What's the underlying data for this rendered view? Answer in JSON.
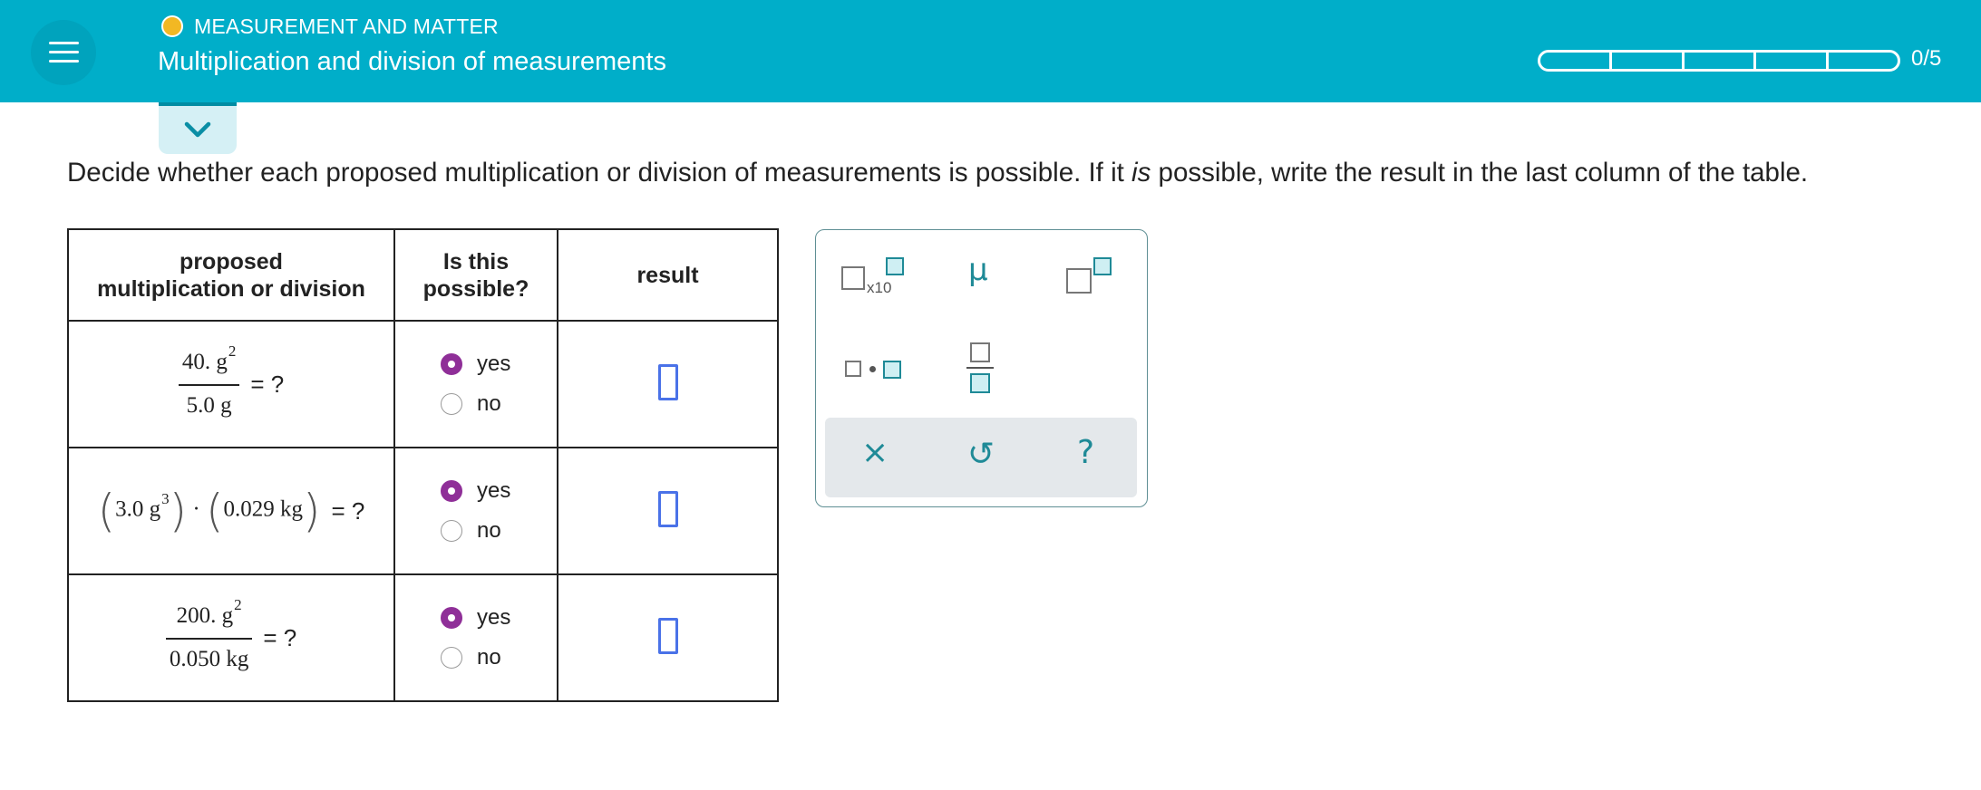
{
  "header": {
    "topic": "MEASUREMENT AND MATTER",
    "title": "Multiplication and division of measurements",
    "progress_text": "0/5",
    "progress_segments": 5,
    "progress_completed": 0
  },
  "instructions": {
    "part1": "Decide whether each proposed multiplication or division of measurements is possible. If it ",
    "emphasis": "is",
    "part2": " possible, write the result in the last column of the table."
  },
  "table": {
    "headers": {
      "col1_line1": "proposed",
      "col1_line2": "multiplication or division",
      "col2_line1": "Is this",
      "col2_line2": "possible?",
      "col3": "result"
    },
    "rows": [
      {
        "numerator": "40. g",
        "numerator_exp": "2",
        "denominator": "5.0 g",
        "equals": "= ?",
        "yes_label": "yes",
        "no_label": "no",
        "selected": "yes"
      },
      {
        "factor1": "3.0 g",
        "factor1_exp": "3",
        "dot": "·",
        "factor2": "0.029 kg",
        "equals": "= ?",
        "yes_label": "yes",
        "no_label": "no",
        "selected": "yes"
      },
      {
        "numerator": "200. g",
        "numerator_exp": "2",
        "denominator": "0.050 kg",
        "equals": "= ?",
        "yes_label": "yes",
        "no_label": "no",
        "selected": "yes"
      }
    ]
  },
  "palette": {
    "x10_label": "x10",
    "mu_label": "μ",
    "clear_icon": "×",
    "undo_icon": "↺",
    "help_icon": "?"
  },
  "colors": {
    "header_bg": "#00aec9",
    "topic_dot": "#f2b823",
    "radio_selected": "#8f2f98",
    "answer_box": "#4a72e8",
    "palette_accent": "#1f8a97"
  }
}
